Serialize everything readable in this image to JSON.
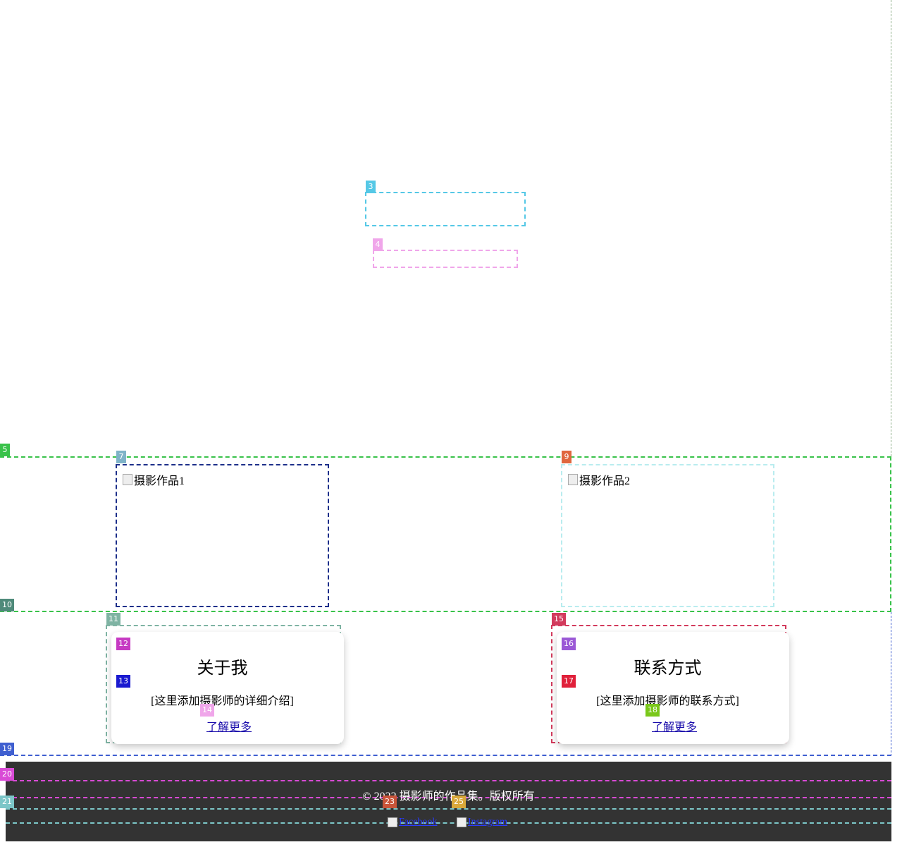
{
  "gallery": {
    "items": [
      {
        "alt": "摄影作品1"
      },
      {
        "alt": "摄影作品2"
      }
    ]
  },
  "about": {
    "title": "关于我",
    "text": "[这里添加摄影师的详细介绍]",
    "link": "了解更多"
  },
  "contact": {
    "title": "联系方式",
    "text": "[这里添加摄影师的联系方式]",
    "link": "了解更多"
  },
  "footer": {
    "copyright": "© 2022 摄影师的作品集。版权所有",
    "social": [
      {
        "name": "facebook-icon",
        "alt": "Facebook"
      },
      {
        "name": "instagram-icon",
        "alt": "Instagram"
      }
    ]
  },
  "tags": [
    "3",
    "4",
    "5",
    "7",
    "9",
    "10",
    "11",
    "12",
    "13",
    "14",
    "15",
    "16",
    "17",
    "18",
    "19",
    "20",
    "21",
    "23",
    "25"
  ],
  "colors": {
    "footer_bg": "#333333",
    "link": "#1a0dab"
  }
}
